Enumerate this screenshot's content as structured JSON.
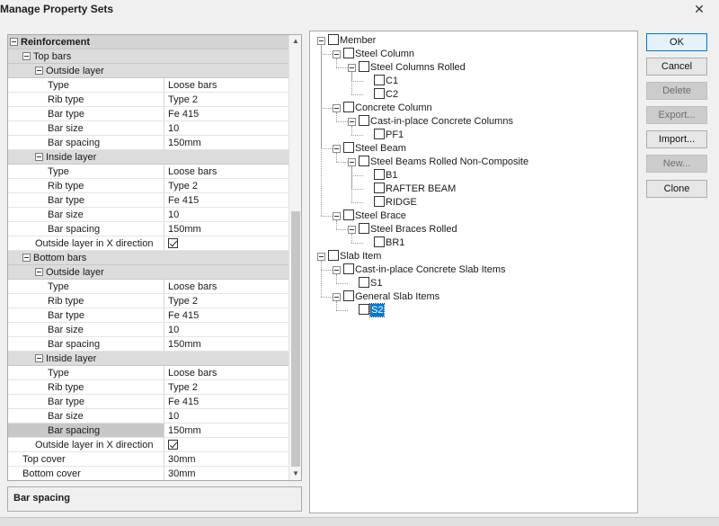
{
  "window": {
    "title": "Manage Property Sets",
    "close_glyph": "✕"
  },
  "grid": {
    "rows": [
      {
        "kind": "cat",
        "level": 0,
        "label": "Reinforcement",
        "root": true
      },
      {
        "kind": "cat",
        "level": 1,
        "label": "Top bars"
      },
      {
        "kind": "cat",
        "level": 2,
        "label": "Outside layer"
      },
      {
        "kind": "prop",
        "level": 3,
        "label": "Type",
        "value": "Loose bars"
      },
      {
        "kind": "prop",
        "level": 3,
        "label": "Rib type",
        "value": "Type 2"
      },
      {
        "kind": "prop",
        "level": 3,
        "label": "Bar type",
        "value": "Fe 415"
      },
      {
        "kind": "prop",
        "level": 3,
        "label": "Bar size",
        "value": "10"
      },
      {
        "kind": "prop",
        "level": 3,
        "label": "Bar spacing",
        "value": "150mm"
      },
      {
        "kind": "cat",
        "level": 2,
        "label": "Inside layer"
      },
      {
        "kind": "prop",
        "level": 3,
        "label": "Type",
        "value": "Loose bars"
      },
      {
        "kind": "prop",
        "level": 3,
        "label": "Rib type",
        "value": "Type 2"
      },
      {
        "kind": "prop",
        "level": 3,
        "label": "Bar type",
        "value": "Fe 415"
      },
      {
        "kind": "prop",
        "level": 3,
        "label": "Bar size",
        "value": "10"
      },
      {
        "kind": "prop",
        "level": 3,
        "label": "Bar spacing",
        "value": "150mm"
      },
      {
        "kind": "prop",
        "level": 2,
        "label": "Outside layer in X direction",
        "checked": true
      },
      {
        "kind": "cat",
        "level": 1,
        "label": "Bottom bars"
      },
      {
        "kind": "cat",
        "level": 2,
        "label": "Outside layer"
      },
      {
        "kind": "prop",
        "level": 3,
        "label": "Type",
        "value": "Loose bars"
      },
      {
        "kind": "prop",
        "level": 3,
        "label": "Rib type",
        "value": "Type 2"
      },
      {
        "kind": "prop",
        "level": 3,
        "label": "Bar type",
        "value": "Fe 415"
      },
      {
        "kind": "prop",
        "level": 3,
        "label": "Bar size",
        "value": "10"
      },
      {
        "kind": "prop",
        "level": 3,
        "label": "Bar spacing",
        "value": "150mm"
      },
      {
        "kind": "cat",
        "level": 2,
        "label": "Inside layer"
      },
      {
        "kind": "prop",
        "level": 3,
        "label": "Type",
        "value": "Loose bars"
      },
      {
        "kind": "prop",
        "level": 3,
        "label": "Rib type",
        "value": "Type 2"
      },
      {
        "kind": "prop",
        "level": 3,
        "label": "Bar type",
        "value": "Fe 415"
      },
      {
        "kind": "prop",
        "level": 3,
        "label": "Bar size",
        "value": "10"
      },
      {
        "kind": "prop",
        "level": 3,
        "label": "Bar spacing",
        "value": "150mm",
        "selected": true
      },
      {
        "kind": "prop",
        "level": 2,
        "label": "Outside layer in X direction",
        "checked": true
      },
      {
        "kind": "prop",
        "level": 1,
        "label": "Top cover",
        "value": "30mm"
      },
      {
        "kind": "prop",
        "level": 1,
        "label": "Bottom cover",
        "value": "30mm"
      }
    ]
  },
  "description": {
    "text": "Bar spacing"
  },
  "tree": {
    "nodes": [
      {
        "level": 0,
        "label": "Member",
        "expander": true
      },
      {
        "level": 1,
        "label": "Steel Column",
        "expander": true
      },
      {
        "level": 2,
        "label": "Steel Columns Rolled",
        "expander": true
      },
      {
        "level": 3,
        "label": "C1"
      },
      {
        "level": 3,
        "label": "C2"
      },
      {
        "level": 1,
        "label": "Concrete Column",
        "expander": true
      },
      {
        "level": 2,
        "label": "Cast-in-place Concrete Columns",
        "expander": true
      },
      {
        "level": 3,
        "label": "PF1"
      },
      {
        "level": 1,
        "label": "Steel Beam",
        "expander": true
      },
      {
        "level": 2,
        "label": "Steel Beams Rolled Non-Composite",
        "expander": true
      },
      {
        "level": 3,
        "label": "B1"
      },
      {
        "level": 3,
        "label": "RAFTER BEAM"
      },
      {
        "level": 3,
        "label": "RIDGE"
      },
      {
        "level": 1,
        "label": "Steel Brace",
        "expander": true
      },
      {
        "level": 2,
        "label": "Steel Braces Rolled",
        "expander": true
      },
      {
        "level": 3,
        "label": "BR1"
      },
      {
        "level": 0,
        "label": "Slab Item",
        "expander": true
      },
      {
        "level": 1,
        "label": "Cast-in-place Concrete Slab Items",
        "expander": true
      },
      {
        "level": 2,
        "label": "S1"
      },
      {
        "level": 1,
        "label": "General Slab Items",
        "expander": true
      },
      {
        "level": 2,
        "label": "S2",
        "selected": true
      }
    ]
  },
  "buttons": {
    "ok": "OK",
    "cancel": "Cancel",
    "delete": "Delete",
    "export": "Export...",
    "import": "Import...",
    "new": "New...",
    "clone": "Clone"
  }
}
